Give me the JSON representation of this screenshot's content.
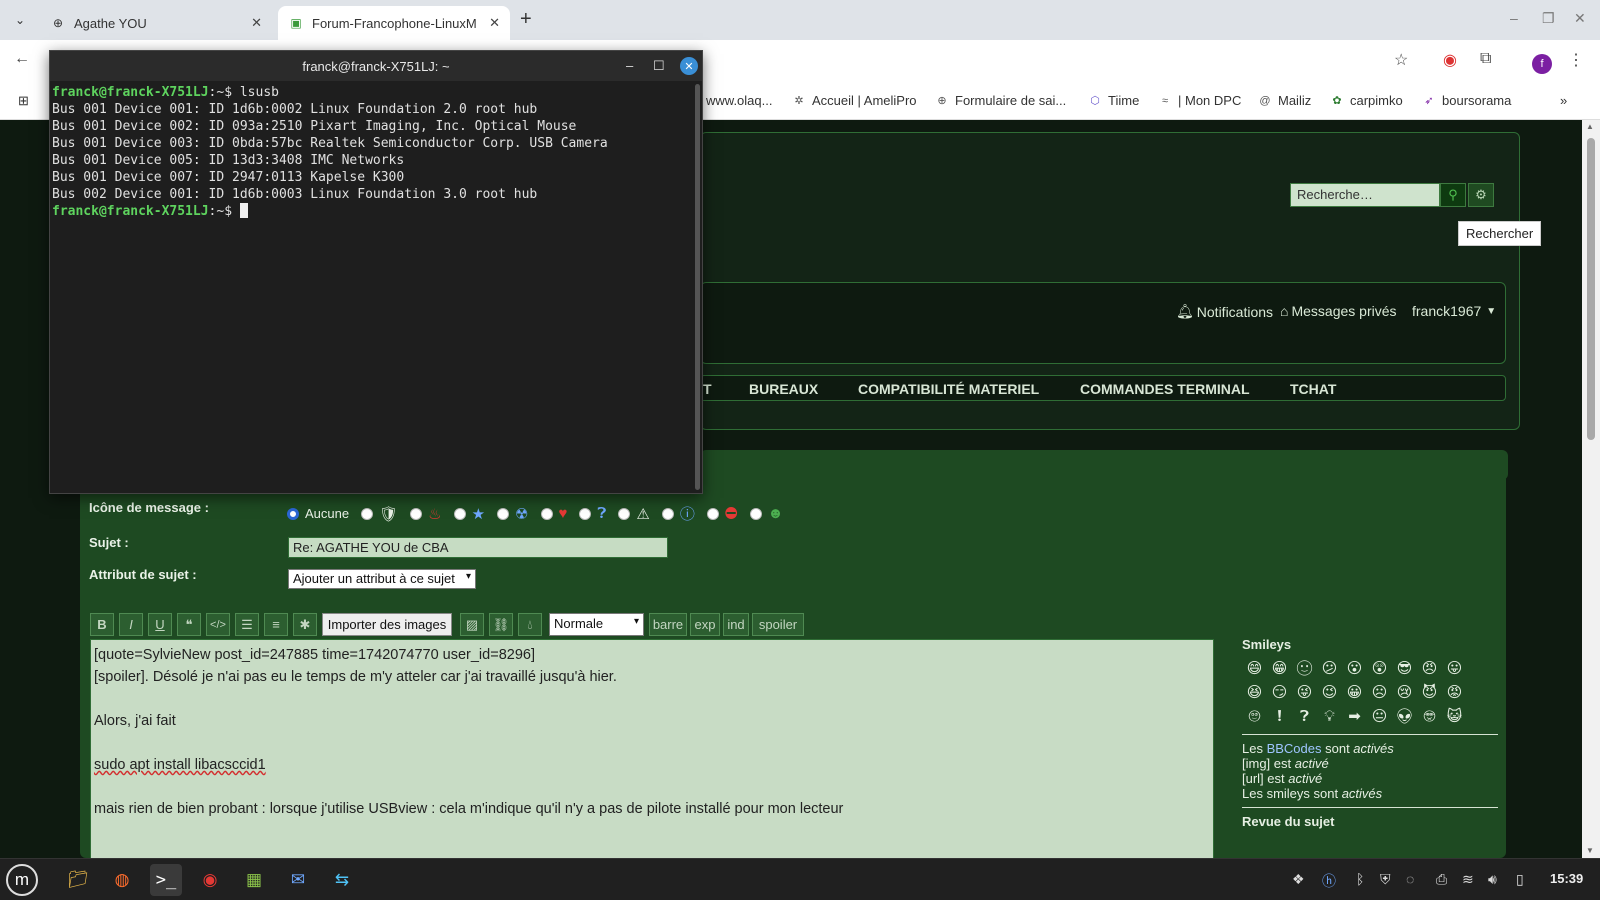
{
  "browser": {
    "tabs": [
      {
        "title": "Agathe YOU",
        "active": false
      },
      {
        "title": "Forum-Francophone-LinuxM",
        "active": true
      }
    ],
    "new_tab": "+",
    "bookmarks": [
      "www.olaq...",
      "Accueil | AmeliPro",
      "Formulaire de sai...",
      "Tiime",
      "| Mon DPC",
      "Mailiz",
      "carpimko",
      "boursorama"
    ],
    "profile_letter": "f"
  },
  "terminal": {
    "title": "franck@franck-X751LJ: ~",
    "prompt": "franck@franck-X751LJ",
    "prompt_suffix": ":~$ ",
    "command": "lsusb",
    "output": [
      "Bus 001 Device 001: ID 1d6b:0002 Linux Foundation 2.0 root hub",
      "Bus 001 Device 002: ID 093a:2510 Pixart Imaging, Inc. Optical Mouse",
      "Bus 001 Device 003: ID 0bda:57bc Realtek Semiconductor Corp. USB Camera",
      "Bus 001 Device 005: ID 13d3:3408 IMC Networks",
      "Bus 001 Device 007: ID 2947:0113 Kapelse K300",
      "Bus 002 Device 001: ID 1d6b:0003 Linux Foundation 3.0 root hub"
    ]
  },
  "forum": {
    "search_placeholder": "Recherche…",
    "search_tooltip": "Rechercher",
    "header_links": {
      "notifications": "Notifications",
      "messages": "Messages privés",
      "user": "franck1967"
    },
    "nav": [
      "T",
      "BUREAUX",
      "COMPATIBILITÉ MATERIEL",
      "COMMANDES TERMINAL",
      "TCHAT"
    ],
    "form": {
      "icon_label": "Icône de message :",
      "icon_none": "Aucune",
      "subject_label": "Sujet :",
      "subject_value": "Re: AGATHE YOU de CBA",
      "attr_label": "Attribut de sujet :",
      "attr_value": "Ajouter un attribut à ce sujet"
    },
    "editor": {
      "import_images": "Importer des images",
      "size_value": "Normale",
      "barre": "barre",
      "exp": "exp",
      "ind": "ind",
      "spoiler": "spoiler",
      "lines": [
        "[quote=SylvieNew post_id=247885 time=1742074770 user_id=8296]",
        "[spoiler]. Désolé je n'ai pas eu le temps de m'y atteler car j'ai travaillé jusqu'à hier.",
        "",
        "Alors, j'ai fait",
        "",
        "sudo apt install libacsccid1",
        "",
        "mais rien de bien probant : lorsque j'utilise USBview : cela m'indique qu'il n'y a pas de pilote installé pour mon lecteur"
      ]
    },
    "sidebar": {
      "title": "Smileys",
      "bbcodes_pre": "Les ",
      "bbcodes_link": "BBCodes",
      "bbcodes_post": " sont ",
      "bbcodes_state": "activés",
      "img_pre": "[img] est ",
      "img_state": "activé",
      "url_pre": "[url] est ",
      "url_state": "activé",
      "smileys_pre": "Les smileys sont ",
      "smileys_state": "activés",
      "review": "Revue du sujet"
    }
  },
  "taskbar": {
    "clock": "15:39"
  }
}
